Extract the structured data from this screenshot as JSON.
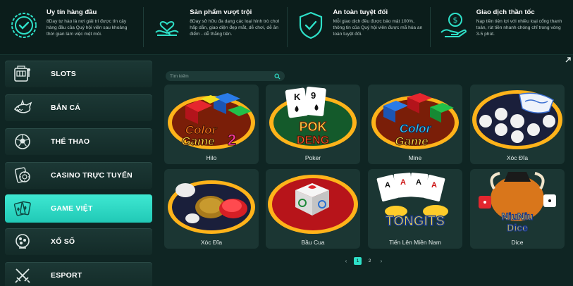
{
  "features": [
    {
      "title": "Uy tín hàng đầu",
      "desc": "8Day tự hào là nơi giải trí được tín cậy hàng đầu của Quý hội viên sau khoảng thời gian làm việc mệt mỏi.",
      "icon": "badge-check-icon"
    },
    {
      "title": "Sản phẩm vượt trội",
      "desc": "8Day sở hữu đa dạng các loại hình trò chơi hấp dẫn, giao diện đẹp mắt, dễ chơi, dễ ăn điểm - dễ thắng tiền.",
      "icon": "hand-heart-icon"
    },
    {
      "title": "An toàn tuyệt đối",
      "desc": "Mỗi giao dịch đều được bảo mật 100%, thông tin của Quý hội viên được mã hóa an toàn tuyệt đối.",
      "icon": "shield-check-icon"
    },
    {
      "title": "Giao dịch thần tốc",
      "desc": "Nạp tiền tiện lợi với nhiều loại cổng thanh toán, rút tiền nhanh chóng chỉ trong vòng 3-5 phút.",
      "icon": "hand-money-icon"
    }
  ],
  "sidebar": {
    "items": [
      {
        "label": "SLOTS",
        "icon": "slot-machine-icon",
        "active": false
      },
      {
        "label": "BẮN CÁ",
        "icon": "shark-icon",
        "active": false
      },
      {
        "label": "THỂ THAO",
        "icon": "soccer-ball-icon",
        "active": false
      },
      {
        "label": "CASINO TRỰC TUYẾN",
        "icon": "casino-chip-icon",
        "active": false
      },
      {
        "label": "GAME VIỆT",
        "icon": "playing-cards-icon",
        "active": true
      },
      {
        "label": "XỔ SỐ",
        "icon": "lottery-ball-icon",
        "active": false
      },
      {
        "label": "ESPORT",
        "icon": "crossed-swords-icon",
        "active": false
      }
    ]
  },
  "search": {
    "placeholder": "Tìm kiếm"
  },
  "games": [
    {
      "name": "Hilo",
      "art": "color-game-2"
    },
    {
      "name": "Poker",
      "art": "pok-deng"
    },
    {
      "name": "Mine",
      "art": "color-game"
    },
    {
      "name": "Xóc Đĩa",
      "art": "xoc-dia-bowl"
    },
    {
      "name": "Xóc Đĩa",
      "art": "xoc-dia-coins"
    },
    {
      "name": "Bầu Cua",
      "art": "bau-cua"
    },
    {
      "name": "Tiến Lên Miền Nam",
      "art": "tongits"
    },
    {
      "name": "Dice",
      "art": "niu-niu-dice"
    }
  ],
  "art_text": {
    "color_game_2": [
      "Color",
      "Game",
      "2"
    ],
    "pok_deng": [
      "POK",
      "DENG"
    ],
    "color_game": [
      "Color",
      "Game"
    ],
    "tongits": "TONGITS",
    "niu_niu": [
      "NiuNiu",
      "Dice"
    ],
    "cards_pok": [
      "K",
      "9"
    ]
  },
  "pagination": {
    "prev": "‹",
    "pages": [
      "1",
      "2"
    ],
    "current": "1",
    "next": "›"
  },
  "colors": {
    "accent": "#2ee0c8",
    "background": "#0f2523",
    "card": "#1b3633"
  }
}
